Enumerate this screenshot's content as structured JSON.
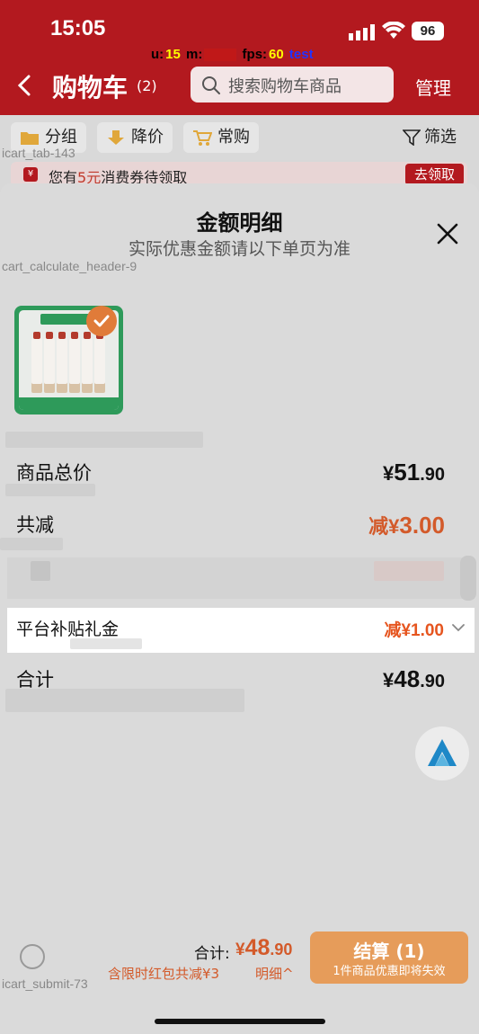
{
  "status_bar": {
    "time": "15:05",
    "battery": "96",
    "debug": {
      "u_label": "u:",
      "u_value": "15",
      "m_label": "m:",
      "fps_label": "fps:",
      "fps_value": "60",
      "test": "test"
    }
  },
  "nav": {
    "title": "购物车",
    "count": "(2)",
    "search_placeholder": "搜索购物车商品",
    "manage": "管理"
  },
  "tabs": [
    {
      "label": "分组",
      "icon": "folder-icon"
    },
    {
      "label": "降价",
      "icon": "price-drop-icon"
    },
    {
      "label": "常购",
      "icon": "cart-icon"
    }
  ],
  "filter": {
    "label": "筛选",
    "icon": "filter-icon"
  },
  "debug_tags": {
    "tab": "icart_tab-143",
    "header": "cart_calculate_header-9",
    "submit": "icart_submit-73"
  },
  "coupon": {
    "prefix": "您有",
    "amount": "5元",
    "suffix": "消费券待领取",
    "button": "去领取"
  },
  "sheet": {
    "title": "金额明细",
    "subtitle": "实际优惠金额请以下单页为准"
  },
  "rows": {
    "total_price": {
      "label": "商品总价",
      "yen": "¥",
      "int": "51",
      "dec": ".90"
    },
    "reduction": {
      "label": "共减",
      "prefix": "减",
      "yen": "¥",
      "value": "3.00"
    },
    "platform_subsidy": {
      "label": "平台补贴礼金",
      "value": "减¥1.00"
    },
    "sum": {
      "label": "合计",
      "yen": "¥",
      "int": "48",
      "dec": ".90"
    }
  },
  "bottom": {
    "total_label": "合计:",
    "total_yen": "¥",
    "total_int": "48",
    "total_dec": ".90",
    "discount_note": "含限时红包共减¥3",
    "detail_link": "明细^",
    "checkout_label": "结算 (1)",
    "checkout_sub": "1件商品优惠即将失效"
  },
  "colors": {
    "header_red": "#b3191f",
    "accent_orange": "#d35a2a",
    "checkout": "#e69c5a"
  }
}
